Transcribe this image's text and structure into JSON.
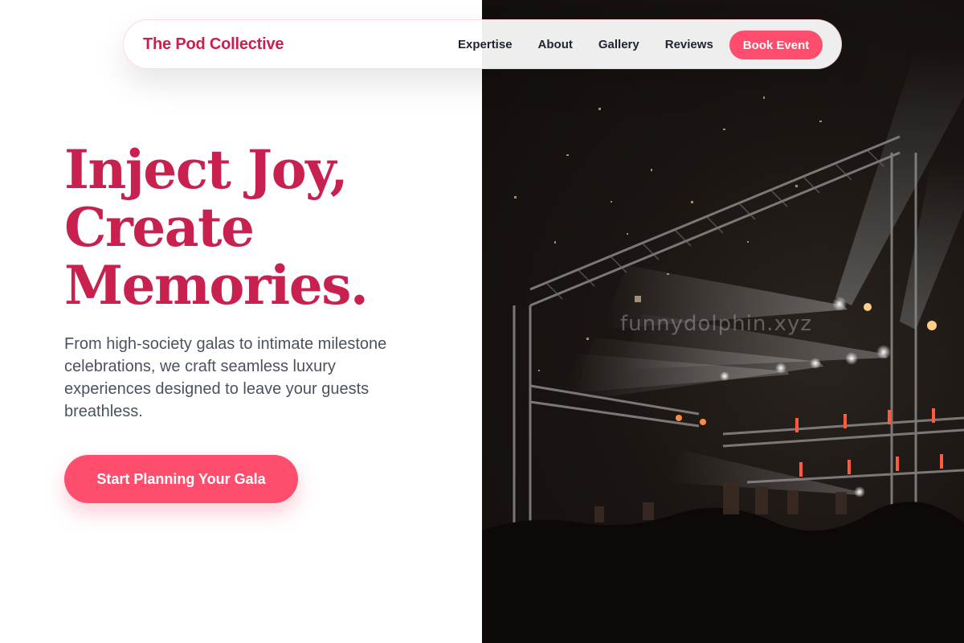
{
  "nav": {
    "brand": "The Pod Collective",
    "links": [
      {
        "label": "Expertise"
      },
      {
        "label": "About"
      },
      {
        "label": "Gallery"
      },
      {
        "label": "Reviews"
      }
    ],
    "cta_label": "Book Event"
  },
  "hero": {
    "headline_lines": [
      "Inject Joy,",
      "Create",
      "Memories."
    ],
    "subtext": "From high-society galas to intimate milestone celebrations, we craft seamless luxury experiences designed to leave your guests breathless.",
    "cta_label": "Start Planning Your Gala",
    "image": {
      "icon": "concert-stage-photo",
      "watermark": "funnydolphin.xyz"
    }
  },
  "colors": {
    "brand": "#c8214f",
    "accent": "#ff4d6d",
    "text_muted": "#4a5260",
    "nav_text": "#1f2530"
  }
}
